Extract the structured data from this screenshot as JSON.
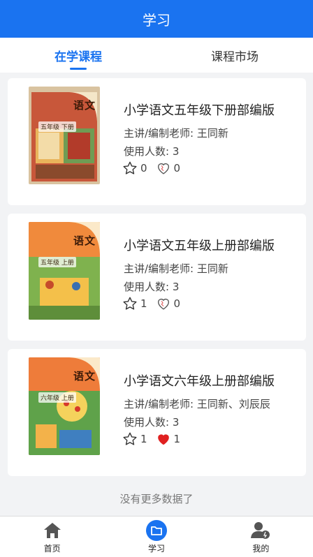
{
  "header": {
    "title": "学习"
  },
  "tabs": [
    {
      "label": "在学课程",
      "active": true
    },
    {
      "label": "课程市场",
      "active": false
    }
  ],
  "courses": [
    {
      "title": "小学语文五年级下册部编版",
      "teacher": "主讲/编制老师: 王同新",
      "users": "使用人数: 3",
      "stars": "0",
      "likes": "0",
      "liked": false,
      "cover": {
        "title": "语文",
        "grade": "五年级 下册",
        "colors": [
          "#c8573a",
          "#e9b45b",
          "#6f9c54"
        ]
      }
    },
    {
      "title": "小学语文五年级上册部编版",
      "teacher": "主讲/编制老师: 王同新",
      "users": "使用人数: 3",
      "stars": "1",
      "likes": "0",
      "liked": false,
      "cover": {
        "title": "语文",
        "grade": "五年级 上册",
        "colors": [
          "#e9672b",
          "#f4c04a",
          "#7fb24e"
        ]
      }
    },
    {
      "title": "小学语文六年级上册部编版",
      "teacher": "主讲/编制老师: 王同新、刘辰辰",
      "users": "使用人数: 3",
      "stars": "1",
      "likes": "1",
      "liked": true,
      "cover": {
        "title": "语文",
        "grade": "六年级 上册",
        "colors": [
          "#e8602a",
          "#f5d25c",
          "#5fa24a"
        ]
      }
    }
  ],
  "footer_text": "没有更多数据了",
  "bottom_nav": [
    {
      "label": "首页",
      "icon": "home-icon",
      "active": false
    },
    {
      "label": "学习",
      "icon": "folder-icon",
      "active": true
    },
    {
      "label": "我的",
      "icon": "user-icon",
      "active": false
    }
  ],
  "colors": {
    "primary": "#1a73f0",
    "liked": "#e02020",
    "background": "#f2f3f5"
  }
}
